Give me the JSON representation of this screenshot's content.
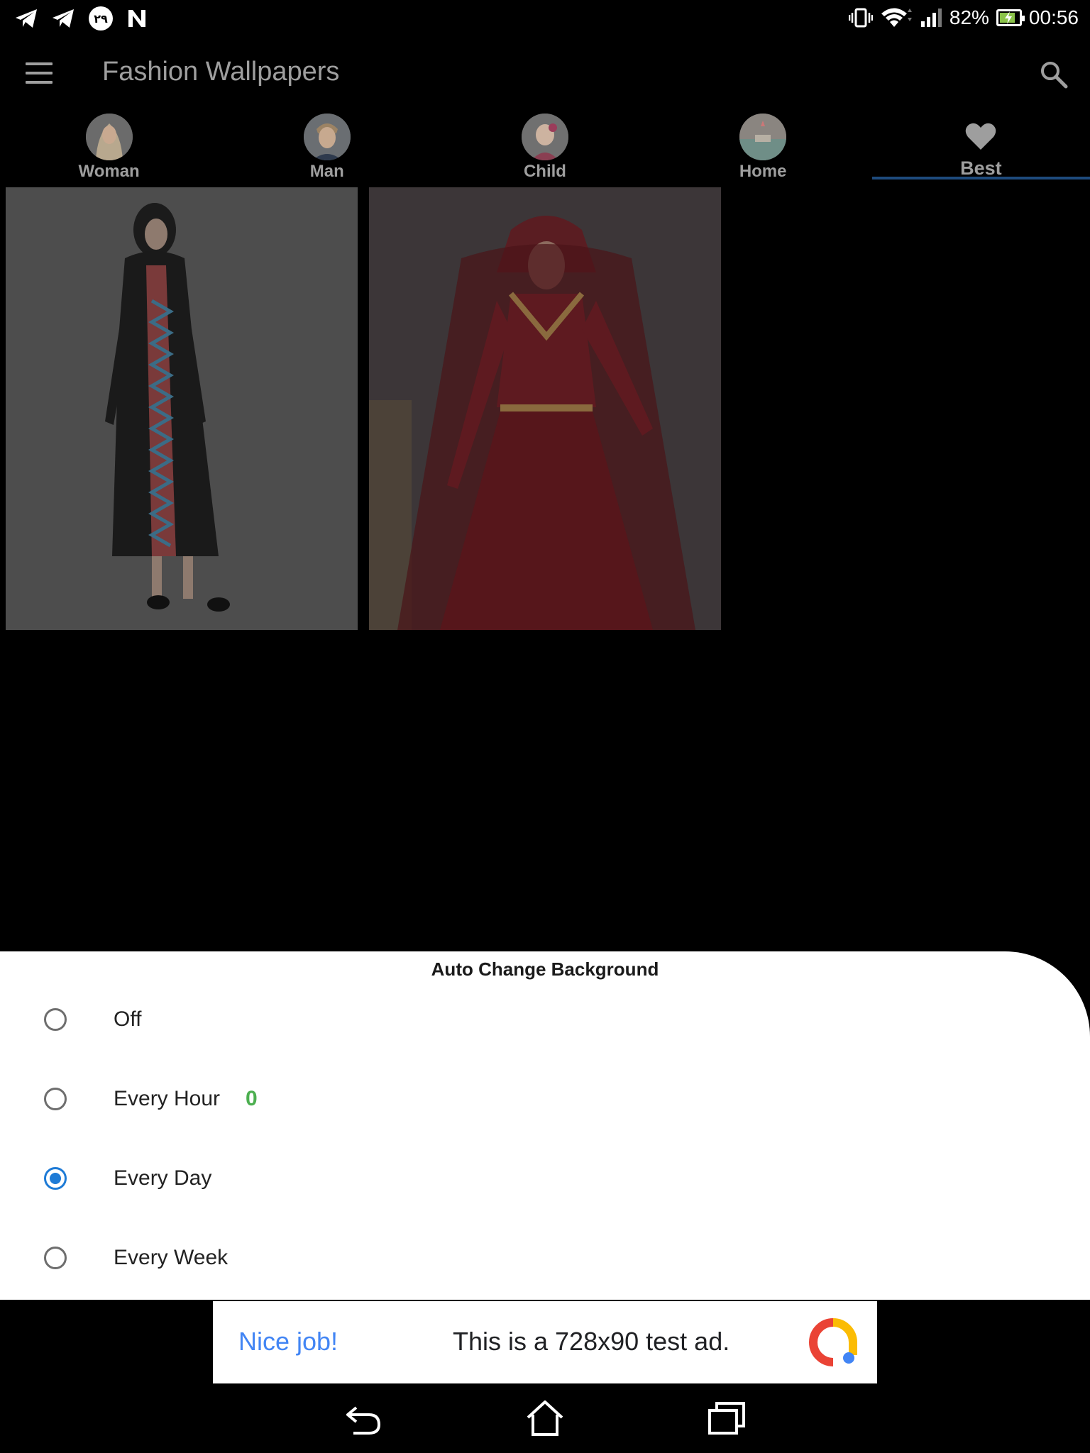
{
  "status_bar": {
    "battery": "82%",
    "time": "00:56",
    "battery_level": 0.82,
    "left_icons": [
      "telegram-icon",
      "telegram-icon",
      "calendar-29-icon",
      "n-icon"
    ],
    "right_icons": [
      "vibrate-icon",
      "wifi-icon",
      "signal-icon",
      "battery-charging-icon"
    ],
    "badge_text": "۲۹"
  },
  "app_bar": {
    "title": "Fashion Wallpapers",
    "menu_icon": "hamburger-menu-icon",
    "search_icon": "search-icon"
  },
  "tabs": [
    {
      "label": "Woman",
      "icon": "woman-avatar"
    },
    {
      "label": "Man",
      "icon": "man-avatar"
    },
    {
      "label": "Child",
      "icon": "child-avatar"
    },
    {
      "label": "Home",
      "icon": "home-avatar"
    },
    {
      "label": "Best",
      "icon": "heart-icon",
      "selected": true
    }
  ],
  "thumbnails": [
    {
      "subject": "black abaya with chevron pattern"
    },
    {
      "subject": "red velvet gown with veil"
    }
  ],
  "sheet": {
    "title": "Auto Change Background",
    "options": [
      {
        "label": "Off",
        "checked": false
      },
      {
        "label": "Every Hour",
        "checked": false,
        "count": "0"
      },
      {
        "label": "Every Day",
        "checked": true
      },
      {
        "label": "Every Week",
        "checked": false
      }
    ]
  },
  "ad": {
    "headline": "Nice job!",
    "text": "This is a 728x90 test ad."
  },
  "nav_bar": {
    "icons": [
      "back-icon",
      "home-icon",
      "recents-icon"
    ]
  },
  "colors": {
    "accent": "#1e7bd6",
    "count_green": "#4caf50",
    "ad_blue": "#4285f4",
    "tab_indicator": "#1e4b7d"
  }
}
